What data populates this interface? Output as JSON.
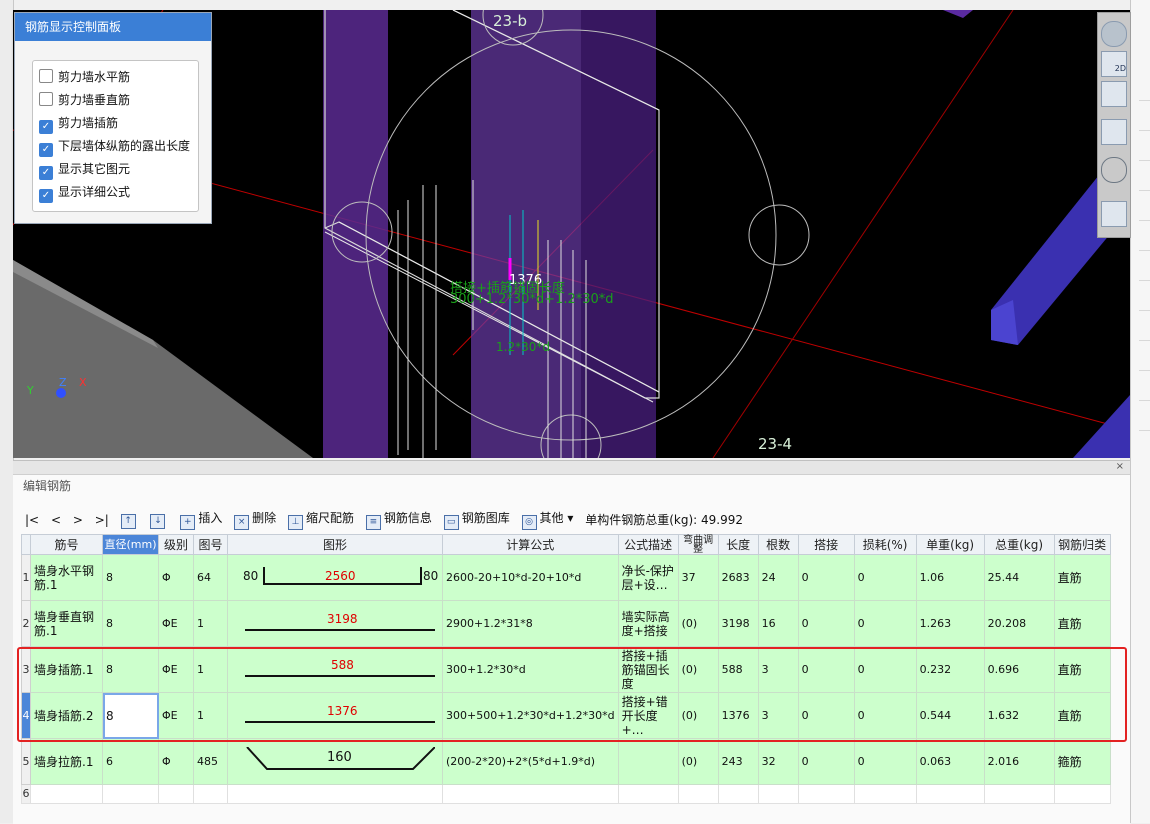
{
  "control_panel": {
    "title": "钢筋显示控制面板",
    "options": [
      {
        "label": "剪力墙水平筋",
        "checked": false
      },
      {
        "label": "剪力墙垂直筋",
        "checked": false
      },
      {
        "label": "剪力墙插筋",
        "checked": true
      },
      {
        "label": "下层墙体纵筋的露出长度",
        "checked": true
      },
      {
        "label": "显示其它图元",
        "checked": true
      },
      {
        "label": "显示详细公式",
        "checked": true
      }
    ]
  },
  "viewport": {
    "axis_labels": {
      "top": "23-b",
      "bottom": "23-4"
    },
    "dimension": "1376",
    "formula_line1": "搭接+插筋锚固长度",
    "formula_line2": "300+1.2*30*d+1.2*30*d",
    "formula_label3": "1.2*30*d",
    "axes": {
      "x": "X",
      "y": "Y",
      "z": "Z"
    },
    "view_buttons": [
      "orbit-icon",
      "2d-icon",
      "top-view-icon",
      "iso-view-icon",
      "rotate-icon",
      "settings-icon"
    ],
    "view_2d_label": "2D"
  },
  "editor": {
    "title": "编辑钢筋",
    "close": "×",
    "toolbar": {
      "nav": [
        "|<",
        "<",
        ">",
        ">|"
      ],
      "insert": "插入",
      "delete": "删除",
      "scale": "缩尺配筋",
      "info": "钢筋信息",
      "library": "钢筋图库",
      "other": "其他",
      "total_label": "单构件钢筋总重(kg):",
      "total_value": "49.992"
    },
    "columns": [
      "筋号",
      "直径(mm)",
      "级别",
      "图号",
      "图形",
      "计算公式",
      "公式描述",
      "弯曲调整",
      "长度",
      "根数",
      "搭接",
      "损耗(%)",
      "单重(kg)",
      "总重(kg)",
      "钢筋归类"
    ],
    "rows": [
      {
        "no": "1",
        "name": "墙身水平钢筋.1",
        "dia": "8",
        "grade": "Φ",
        "fig": "64",
        "shape_left": "80",
        "shape_mid": "2560",
        "shape_right": "80",
        "formula": "2600-20+10*d-20+10*d",
        "desc": "净长-保护层+设…",
        "bend": "37",
        "length": "2683",
        "count": "24",
        "lap": "0",
        "loss": "0",
        "unit_wt": "1.06",
        "total_wt": "25.44",
        "category": "直筋"
      },
      {
        "no": "2",
        "name": "墙身垂直钢筋.1",
        "dia": "8",
        "grade": "ΦE",
        "fig": "1",
        "shape_left": "",
        "shape_mid": "3198",
        "shape_right": "",
        "formula": "2900+1.2*31*8",
        "desc": "墙实际高度+搭接",
        "bend": "(0)",
        "length": "3198",
        "count": "16",
        "lap": "0",
        "loss": "0",
        "unit_wt": "1.263",
        "total_wt": "20.208",
        "category": "直筋"
      },
      {
        "no": "3",
        "name": "墙身插筋.1",
        "dia": "8",
        "grade": "ΦE",
        "fig": "1",
        "shape_left": "",
        "shape_mid": "588",
        "shape_right": "",
        "formula": "300+1.2*30*d",
        "desc": "搭接+插筋锚固长度",
        "bend": "(0)",
        "length": "588",
        "count": "3",
        "lap": "0",
        "loss": "0",
        "unit_wt": "0.232",
        "total_wt": "0.696",
        "category": "直筋"
      },
      {
        "no": "4",
        "name": "墙身插筋.2",
        "dia": "8",
        "grade": "ΦE",
        "fig": "1",
        "shape_left": "",
        "shape_mid": "1376",
        "shape_right": "",
        "formula": "300+500+1.2*30*d+1.2*30*d",
        "desc": "搭接+错开长度+…",
        "bend": "(0)",
        "length": "1376",
        "count": "3",
        "lap": "0",
        "loss": "0",
        "unit_wt": "0.544",
        "total_wt": "1.632",
        "category": "直筋"
      },
      {
        "no": "5",
        "name": "墙身拉筋.1",
        "dia": "6",
        "grade": "Φ",
        "fig": "485",
        "shape_left": "",
        "shape_mid": "160",
        "shape_right": "",
        "formula": "(200-2*20)+2*(5*d+1.9*d)",
        "desc": "",
        "bend": "(0)",
        "length": "243",
        "count": "32",
        "lap": "0",
        "loss": "0",
        "unit_wt": "0.063",
        "total_wt": "2.016",
        "category": "箍筋"
      },
      {
        "no": "6"
      }
    ]
  }
}
